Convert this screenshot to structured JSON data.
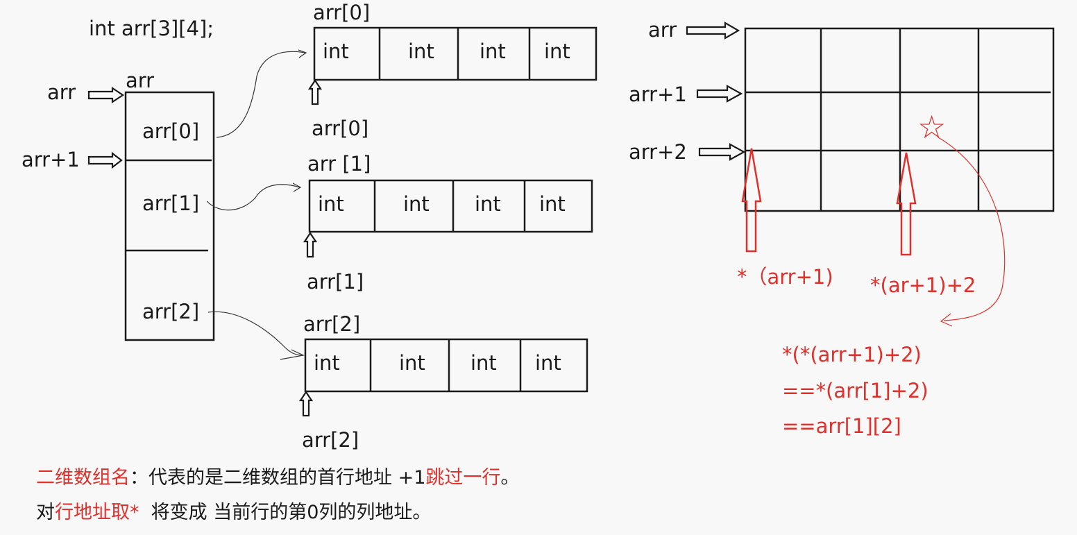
{
  "declaration": "int arr[3][4];",
  "left_block": {
    "top_label": "arr",
    "pointer_arr": "arr",
    "pointer_arr1": "arr+1",
    "rows": [
      "arr[0]",
      "arr[1]",
      "arr[2]"
    ]
  },
  "middle_rows": [
    {
      "title": "arr[0]",
      "cells": [
        "int",
        "int",
        "int",
        "int"
      ],
      "pointer_label": "arr[0]"
    },
    {
      "title": "arr [1]",
      "cells": [
        "int",
        "int",
        "int",
        "int"
      ],
      "pointer_label": "arr[1]"
    },
    {
      "title": "arr[2]",
      "cells": [
        "int",
        "int",
        "int",
        "int"
      ],
      "pointer_label": "arr[2]"
    }
  ],
  "right_grid": {
    "pointers": [
      "arr",
      "arr+1",
      "arr+2"
    ],
    "annotations": [
      "*（arr+1)",
      "*(ar+1)+2"
    ],
    "star_icon": "☆",
    "equations": [
      "*(*(arr+1)+2)",
      "==*(arr[1]+2)",
      "==arr[1][2]"
    ]
  },
  "notes": {
    "line1": {
      "red": "二维数组名",
      "black": "：代表的是二维数组的首行地址 +1",
      "red2": "跳过一行",
      "tail": "。"
    },
    "line2": {
      "black": "对",
      "red": "行地址取*",
      "black2": "  将变成 当前行的第0列的列地址。"
    }
  },
  "colors": {
    "ink": "#1a1a1a",
    "accent": "#e0302b",
    "background": "#f8f8f8"
  }
}
